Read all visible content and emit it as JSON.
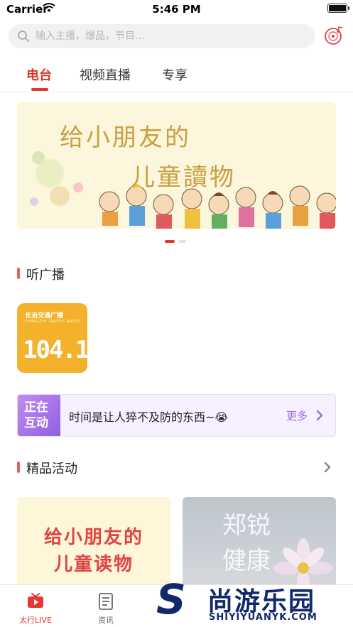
{
  "status_bar": {
    "carrier": "Carrier",
    "time": "5:46 PM"
  },
  "search": {
    "placeholder": "输入主播，爆品，节目..."
  },
  "tabs": [
    {
      "label": "电台",
      "active": true
    },
    {
      "label": "视频直播",
      "active": false
    },
    {
      "label": "专享",
      "active": false
    }
  ],
  "banner": {
    "line1": "给小朋友的",
    "line2": "儿童讀物",
    "page_count": 2,
    "active_page": 1
  },
  "sections": {
    "radio": {
      "title": "听广播"
    },
    "activities": {
      "title": "精品活动"
    }
  },
  "radio_station": {
    "name": "长治交通广播",
    "subtitle": "CHANGZHI TRAFFIC RADIO",
    "frequency": "104.1"
  },
  "live_strip": {
    "badge_line1": "正在",
    "badge_line2": "互动",
    "message": "时间是让人猝不及防的东西~😭",
    "more": "更多"
  },
  "activity_cards": [
    {
      "line1": "给小朋友的",
      "line2": "儿童读物"
    },
    {
      "line1": "郑锐",
      "line2": "健康"
    }
  ],
  "tabbar": [
    {
      "label": "太行LIVE",
      "icon": "tv-icon",
      "active": true
    },
    {
      "label": "资讯",
      "icon": "news-icon",
      "active": false
    }
  ],
  "watermark": {
    "letter": "S",
    "title": "尚游乐园",
    "url": "SHIYIYUANYK.COM"
  },
  "colors": {
    "accent": "#d93a2b",
    "purple": "#9b6fe0",
    "radio_tile": "#f4b22c",
    "watermark": "#12286a"
  }
}
